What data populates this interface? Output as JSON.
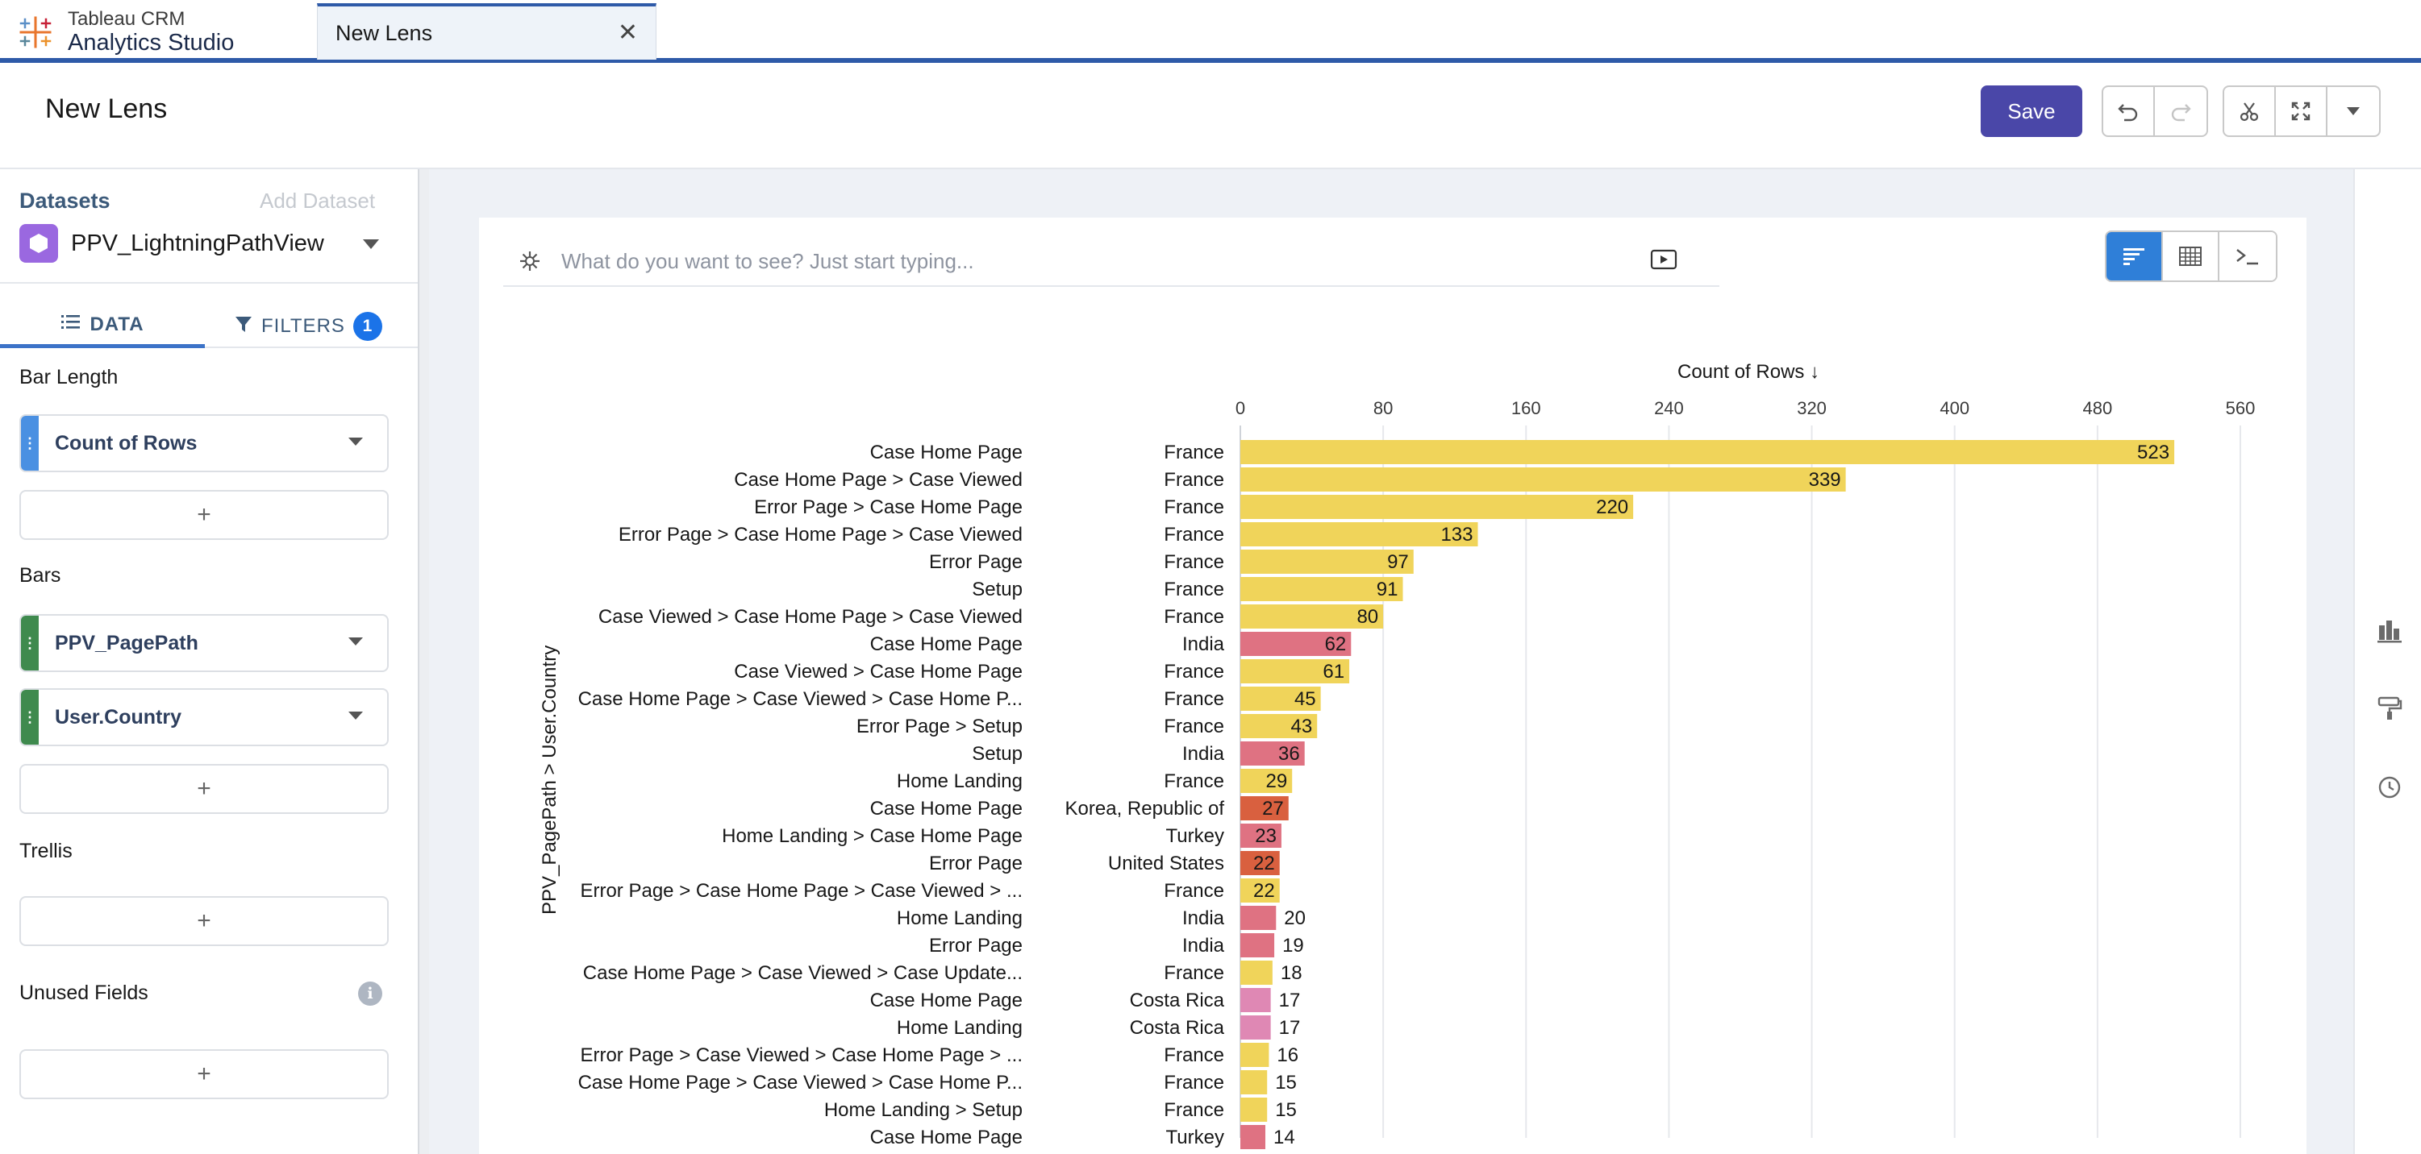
{
  "app": {
    "brand_line1": "Tableau CRM",
    "brand_line2": "Analytics Studio",
    "tab_label": "New Lens",
    "tab_close_icon": "close-icon"
  },
  "header": {
    "title": "New Lens",
    "save_label": "Save",
    "undo_icon": "undo-icon",
    "redo_icon": "redo-icon",
    "clip_icon": "scissors-icon",
    "expand_icon": "expand-icon",
    "more_icon": "chevron-down-icon"
  },
  "left_panel": {
    "datasets_title": "Datasets",
    "add_dataset": "Add Dataset",
    "dataset_name": "PPV_LightningPathView",
    "tab_data": "DATA",
    "tab_filters": "FILTERS",
    "filters_count": "1",
    "sections": {
      "bar_length": "Bar Length",
      "bars": "Bars",
      "trellis": "Trellis",
      "unused_fields": "Unused Fields"
    },
    "fields": {
      "measure": "Count of Rows",
      "group1": "PPV_PagePath",
      "group2": "User.Country"
    },
    "add_symbol": "+",
    "info_symbol": "i",
    "colors": {
      "measure_handle": "#4a90e2",
      "dimension_handle": "#3f8a4e"
    }
  },
  "canvas": {
    "ask_placeholder": "What do you want to see? Just start typing...",
    "viz_toggle": [
      "bar-chart-icon",
      "table-icon",
      "query-icon"
    ],
    "right_rail": [
      "chart-type-icon",
      "format-icon",
      "history-icon"
    ]
  },
  "chart_data": {
    "type": "bar",
    "orientation": "horizontal",
    "title": "",
    "xlabel": "Count of Rows ↓",
    "ylabel": "PPV_PagePath > User.Country",
    "xlim": [
      0,
      560
    ],
    "x_ticks": [
      0,
      80,
      160,
      240,
      320,
      400,
      480,
      560
    ],
    "grid": true,
    "country_colors": {
      "France": "#f0d45a",
      "India": "#df7282",
      "Korea, Republic of": "#d9603f",
      "Turkey": "#df7282",
      "United States": "#d9603f",
      "Costa Rica": "#df88b4"
    },
    "rows": [
      {
        "path": "Case Home Page",
        "country": "France",
        "value": 523
      },
      {
        "path": "Case Home Page > Case Viewed",
        "country": "France",
        "value": 339
      },
      {
        "path": "Error Page > Case Home Page",
        "country": "France",
        "value": 220
      },
      {
        "path": "Error Page > Case Home Page > Case Viewed",
        "country": "France",
        "value": 133
      },
      {
        "path": "Error Page",
        "country": "France",
        "value": 97
      },
      {
        "path": "Setup",
        "country": "France",
        "value": 91
      },
      {
        "path": "Case Viewed > Case Home Page > Case Viewed",
        "country": "France",
        "value": 80
      },
      {
        "path": "Case Home Page",
        "country": "India",
        "value": 62
      },
      {
        "path": "Case Viewed > Case Home Page",
        "country": "France",
        "value": 61
      },
      {
        "path": "Case Home Page > Case Viewed > Case Home P...",
        "country": "France",
        "value": 45
      },
      {
        "path": "Error Page > Setup",
        "country": "France",
        "value": 43
      },
      {
        "path": "Setup",
        "country": "India",
        "value": 36
      },
      {
        "path": "Home Landing",
        "country": "France",
        "value": 29
      },
      {
        "path": "Case Home Page",
        "country": "Korea, Republic of",
        "value": 27
      },
      {
        "path": "Home Landing > Case Home Page",
        "country": "Turkey",
        "value": 23
      },
      {
        "path": "Error Page",
        "country": "United States",
        "value": 22
      },
      {
        "path": "Error Page > Case Home Page > Case Viewed > ...",
        "country": "France",
        "value": 22
      },
      {
        "path": "Home Landing",
        "country": "India",
        "value": 20
      },
      {
        "path": "Error Page",
        "country": "India",
        "value": 19
      },
      {
        "path": "Case Home Page > Case Viewed > Case Update...",
        "country": "France",
        "value": 18
      },
      {
        "path": "Case Home Page",
        "country": "Costa Rica",
        "value": 17
      },
      {
        "path": "Home Landing",
        "country": "Costa Rica",
        "value": 17
      },
      {
        "path": "Error Page > Case Viewed > Case Home Page > ...",
        "country": "France",
        "value": 16
      },
      {
        "path": "Case Home Page > Case Viewed > Case Home P...",
        "country": "France",
        "value": 15
      },
      {
        "path": "Home Landing > Setup",
        "country": "France",
        "value": 15
      },
      {
        "path": "Case Home Page",
        "country": "Turkey",
        "value": 14
      }
    ]
  }
}
